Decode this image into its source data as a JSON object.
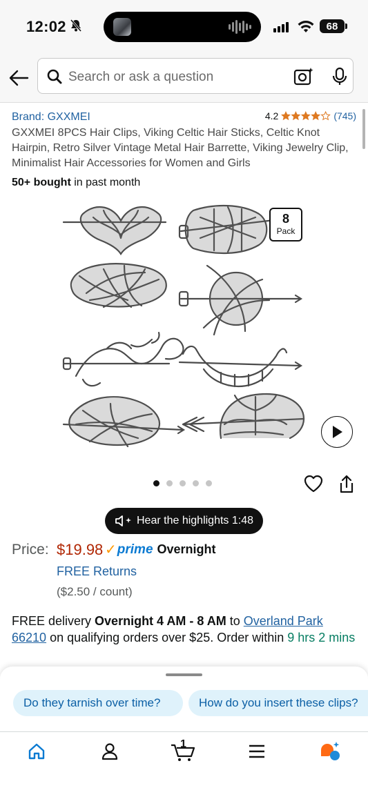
{
  "status_bar": {
    "time": "12:02",
    "battery": "68"
  },
  "search": {
    "placeholder": "Search or ask a question"
  },
  "product": {
    "brand": "Brand: GXXMEI",
    "rating": "4.2",
    "rating_count": "(745)",
    "title": "GXXMEI 8PCS Hair Clips, Viking Celtic Hair Sticks, Celtic Knot Hairpin, Retro Silver Vintage Metal Hair Barrette, Viking Jewelry Clip, Minimalist Hair Accessories for Women and Girls",
    "bought_bold": "50+ bought",
    "bought_rest": " in past month",
    "pack_number": "8",
    "pack_label": "Pack",
    "image_count": 5,
    "active_image": 0
  },
  "highlights": {
    "label": "Hear the highlights 1:48"
  },
  "price": {
    "label": "Price:",
    "value": "$19.98",
    "prime": "prime",
    "prime_speed": "Overnight",
    "free_returns": "FREE Returns",
    "per_count": "($2.50 / count)"
  },
  "delivery": {
    "prefix": "FREE delivery ",
    "window": "Overnight 4 AM - 8 AM",
    "to": " to ",
    "location_line1": "Overland Park",
    "location_line2": "66210",
    "mid": " on qualifying orders over $25. Order within ",
    "countdown": "9 hrs 2 mins"
  },
  "suggestions": [
    "Do they tarnish over time?",
    "How do you insert these clips?"
  ],
  "colors": {
    "link": "#2162a1",
    "price": "#b12704",
    "prime_blue": "#0a7ad2",
    "prime_check": "#ff9900",
    "star": "#de7921",
    "chip_bg": "#dff2fb",
    "home_active": "#0a7ad2",
    "rufus_orange": "#ff6a14",
    "rufus_blue": "#1f8ad8"
  },
  "nav": {
    "cart_count": "1",
    "items": [
      "home-icon",
      "account-icon",
      "cart-icon",
      "menu-icon",
      "rufus-icon"
    ]
  }
}
